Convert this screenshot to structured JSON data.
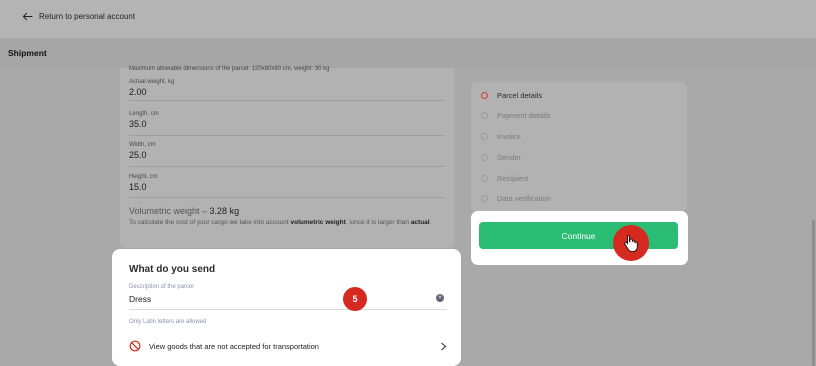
{
  "header": {
    "back_label": "Return to personal account",
    "title": "Shipment"
  },
  "form": {
    "cut_text": "Maximum allowable dimensions of the parcel: 120x80x80 cm, weight: 30 kg",
    "fields": [
      {
        "label": "Actual weight, kg",
        "value": "2.00"
      },
      {
        "label": "Length, cm",
        "value": "35.0"
      },
      {
        "label": "Width, cm",
        "value": "25.0"
      },
      {
        "label": "Height, cm",
        "value": "15.0"
      }
    ],
    "volumetric_prefix": "Volumetric weight – ",
    "volumetric_value": "3.28 kg",
    "note_part1": "To calculate the cost of your cargo we take into account ",
    "note_bold1": "volumetric weight",
    "note_part2": ", since it is larger than ",
    "note_bold2": "actual",
    "note_end": "."
  },
  "steps": [
    {
      "label": "Parcel details",
      "active": true
    },
    {
      "label": "Payment details",
      "active": false
    },
    {
      "label": "Invoice",
      "active": false
    },
    {
      "label": "Sender",
      "active": false
    },
    {
      "label": "Recipient",
      "active": false
    },
    {
      "label": "Data verification",
      "active": false
    }
  ],
  "continue_label": "Continue",
  "send": {
    "title": "What do you send",
    "desc_label": "Description of the parcel",
    "desc_value": "Dress",
    "hint": "Only Latin letters are allowed",
    "view_goods": "View goods that are not accepted for transportation",
    "badge": "5"
  },
  "colors": {
    "accent_green": "#2bbd74",
    "highlight_red": "#d6291f"
  }
}
